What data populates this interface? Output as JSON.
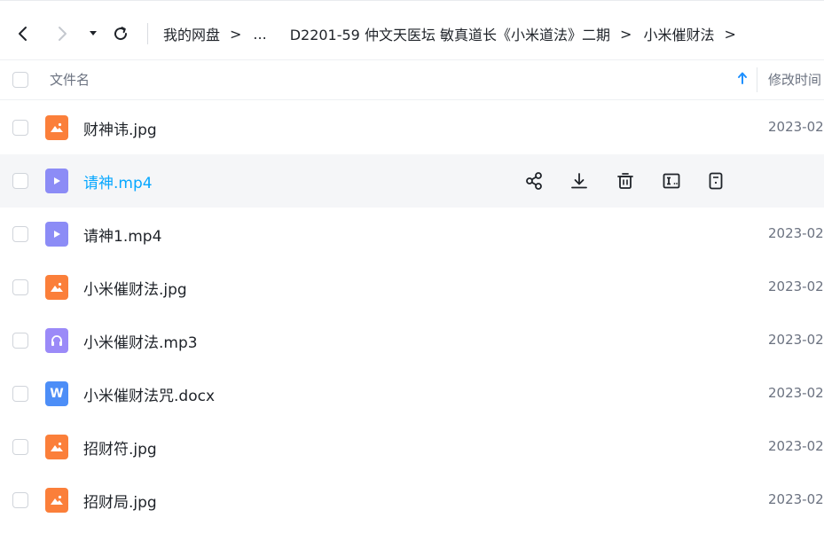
{
  "nav": {
    "breadcrumb": [
      {
        "label": "我的网盘"
      },
      {
        "label": "..."
      },
      {
        "label": "D2201-59 仲文天医坛 敏真道长《小米道法》二期"
      },
      {
        "label": "小米催财法"
      }
    ],
    "trailing_separator": ">"
  },
  "table": {
    "header": {
      "name": "文件名",
      "modified": "修改时间"
    },
    "files": [
      {
        "name": "财神讳.jpg",
        "type": "image",
        "date": "2023-02"
      },
      {
        "name": "请神.mp4",
        "type": "video",
        "date": ""
      },
      {
        "name": "请神1.mp4",
        "type": "video",
        "date": "2023-02"
      },
      {
        "name": "小米催财法.jpg",
        "type": "image",
        "date": "2023-02"
      },
      {
        "name": "小米催财法.mp3",
        "type": "audio",
        "date": "2023-02"
      },
      {
        "name": "小米催财法咒.docx",
        "type": "word",
        "date": "2023-02"
      },
      {
        "name": "招财符.jpg",
        "type": "image",
        "date": "2023-02"
      },
      {
        "name": "招财局.jpg",
        "type": "image",
        "date": "2023-02"
      }
    ],
    "word_icon_letter": "W"
  },
  "colors": {
    "accent": "#06a7ff",
    "image_icon": "#fb7f3a",
    "video_icon": "#8c8cf6",
    "audio_icon": "#9b8af8",
    "word_icon": "#4d8ef7",
    "sort_arrow": "#1e90ff"
  },
  "icons": {
    "row_actions": [
      "share-icon",
      "download-icon",
      "delete-icon",
      "rename-icon",
      "more-icon"
    ]
  }
}
